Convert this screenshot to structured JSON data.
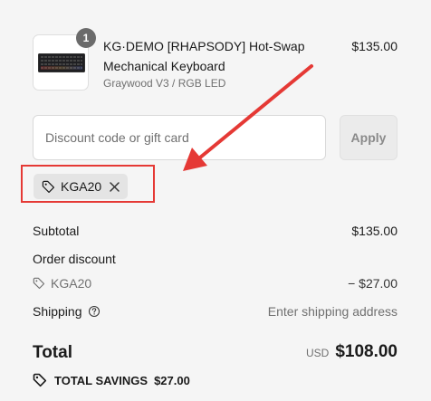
{
  "product": {
    "quantity": "1",
    "title": "KG·DEMO [RHAPSODY] Hot-Swap Mechanical Keyboard",
    "variant": "Graywood V3 / RGB LED",
    "price": "$135.00",
    "image": "keyboard-thumbnail"
  },
  "discount": {
    "placeholder": "Discount code or gift card",
    "value": "",
    "apply_label": "Apply",
    "applied_code": "KGA20"
  },
  "summary": {
    "subtotal_label": "Subtotal",
    "subtotal_value": "$135.00",
    "order_discount_label": "Order discount",
    "discount_code": "KGA20",
    "discount_amount": "− $27.00",
    "shipping_label": "Shipping",
    "shipping_value": "Enter shipping address",
    "total_label": "Total",
    "currency": "USD",
    "total_amount": "$108.00",
    "savings_label": "TOTAL SAVINGS",
    "savings_amount": "$27.00"
  },
  "colors": {
    "background": "#f5f5f5",
    "annotation_red": "#e53935",
    "text_primary": "#1a1a1a",
    "text_secondary": "#707070",
    "chip_background": "#e4e4e4",
    "badge_background": "#6b6b6b"
  },
  "icons": {
    "chip_tag": "tag-icon",
    "chip_remove": "close-icon",
    "discount_tag": "tag-icon",
    "shipping_help": "question-circle-icon",
    "savings": "tag-icon"
  }
}
